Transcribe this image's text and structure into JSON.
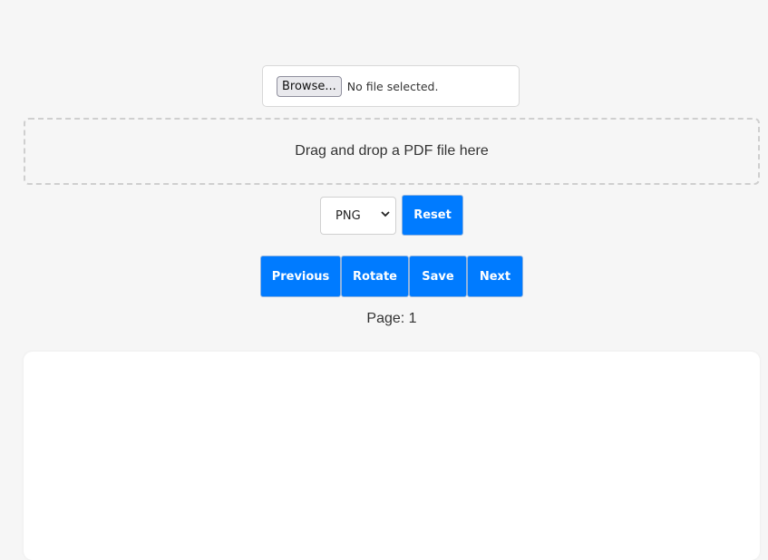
{
  "file_input": {
    "browse_label": "Browse...",
    "status": "No file selected."
  },
  "dropzone": {
    "text": "Drag and drop a PDF file here"
  },
  "format": {
    "selected": "PNG",
    "chevron": "⌄"
  },
  "buttons": {
    "reset": "Reset",
    "previous": "Previous",
    "rotate": "Rotate",
    "save": "Save",
    "next": "Next"
  },
  "pager": {
    "label": "Page: 1"
  },
  "colors": {
    "accent": "#007bff",
    "background": "#f6f6f6"
  }
}
